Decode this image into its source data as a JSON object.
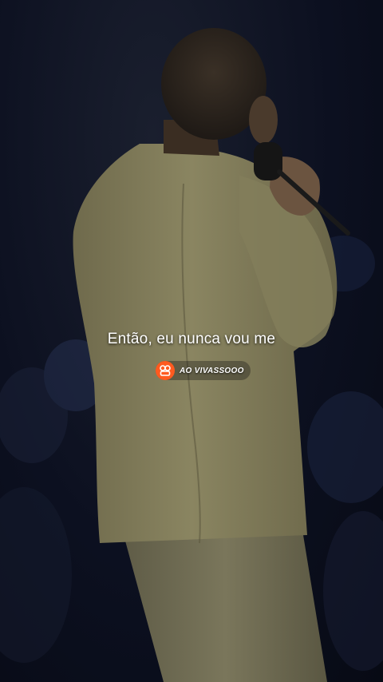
{
  "video": {
    "subtitle": "Então, eu nunca vou me",
    "watermark": {
      "icon": "kwai-logo-icon",
      "username": "AO VIVASSOOO",
      "accent_color": "#ff5a1f"
    }
  }
}
